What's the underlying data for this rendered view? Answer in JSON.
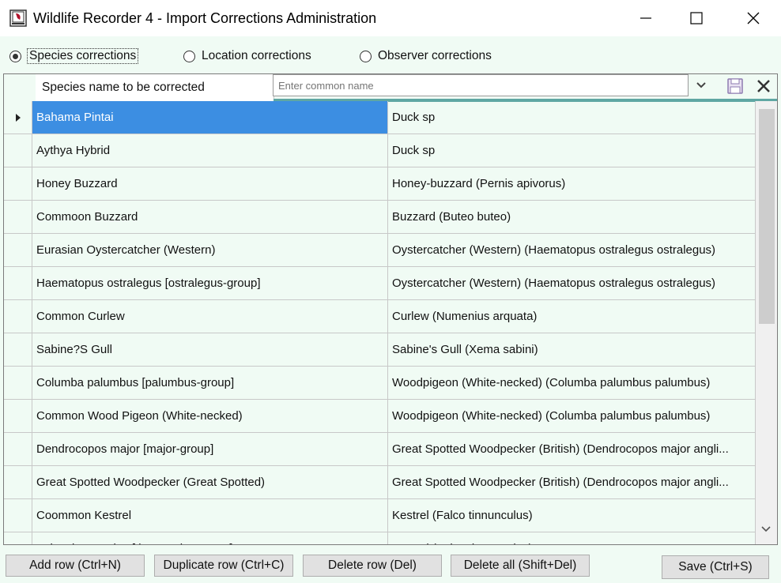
{
  "window": {
    "title": "Wildlife Recorder 4 - Import Corrections Administration"
  },
  "radios": [
    {
      "label": "Species corrections",
      "selected": true
    },
    {
      "label": "Location corrections",
      "selected": false
    },
    {
      "label": "Observer corrections",
      "selected": false
    }
  ],
  "grid": {
    "header": "Species name to be corrected",
    "filter_placeholder": "Enter common name",
    "rows": [
      {
        "from": "Bahama Pintai",
        "to": "Duck sp"
      },
      {
        "from": "Aythya Hybrid",
        "to": "Duck sp"
      },
      {
        "from": "Honey Buzzard",
        "to": "Honey-buzzard (Pernis apivorus)"
      },
      {
        "from": "Commoon Buzzard",
        "to": "Buzzard (Buteo buteo)"
      },
      {
        "from": "Eurasian Oystercatcher (Western)",
        "to": "Oystercatcher (Western) (Haematopus ostralegus ostralegus)"
      },
      {
        "from": "Haematopus ostralegus [ostralegus-group]",
        "to": "Oystercatcher (Western) (Haematopus ostralegus ostralegus)"
      },
      {
        "from": "Common Curlew",
        "to": "Curlew (Numenius arquata)"
      },
      {
        "from": "Sabine?S Gull",
        "to": "Sabine's Gull (Xema sabini)"
      },
      {
        "from": "Columba palumbus [palumbus-group]",
        "to": "Woodpigeon (White-necked) (Columba palumbus palumbus)"
      },
      {
        "from": "Common Wood Pigeon (White-necked)",
        "to": "Woodpigeon (White-necked) (Columba palumbus palumbus)"
      },
      {
        "from": "Dendrocopos major [major-group]",
        "to": "Great Spotted Woodpecker (British) (Dendrocopos major angli..."
      },
      {
        "from": "Great Spotted Woodpecker (Great Spotted)",
        "to": "Great Spotted Woodpecker (British) (Dendrocopos major angli..."
      },
      {
        "from": "Coommon Kestrel",
        "to": "Kestrel (Falco tinnunculus)"
      },
      {
        "from": "Falco tinnunculus [tinnunculus-group]",
        "to": "Kestrel (Falco tinnunculus)"
      }
    ]
  },
  "buttons": {
    "add": "Add row (Ctrl+N)",
    "duplicate": "Duplicate row (Ctrl+C)",
    "delete": "Delete row (Del)",
    "delete_all": "Delete all (Shift+Del)",
    "save": "Save (Ctrl+S)"
  },
  "colors": {
    "background": "#f0fbf4",
    "selection": "#3c8ee2",
    "accent_underline": "#5fa7a3"
  }
}
